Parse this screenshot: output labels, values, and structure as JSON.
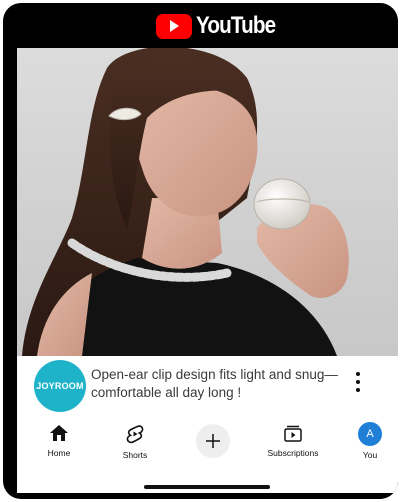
{
  "header": {
    "brand": "YouTube"
  },
  "ad": {
    "channel_avatar_text": "JOYROOM",
    "description": "Open-ear clip design fits light and snug—comfortable all day long !"
  },
  "bottom_nav": {
    "items": [
      {
        "label": "Home",
        "icon": "home-icon"
      },
      {
        "label": "Shorts",
        "icon": "shorts-icon"
      },
      {
        "label": "",
        "icon": "plus-icon"
      },
      {
        "label": "Subscriptions",
        "icon": "subscriptions-icon"
      },
      {
        "label": "You",
        "icon": "avatar",
        "avatar_letter": "A"
      }
    ]
  },
  "colors": {
    "brand_red": "#ff0000",
    "avatar_teal": "#1fb3c9",
    "you_blue": "#1f7fd6"
  }
}
